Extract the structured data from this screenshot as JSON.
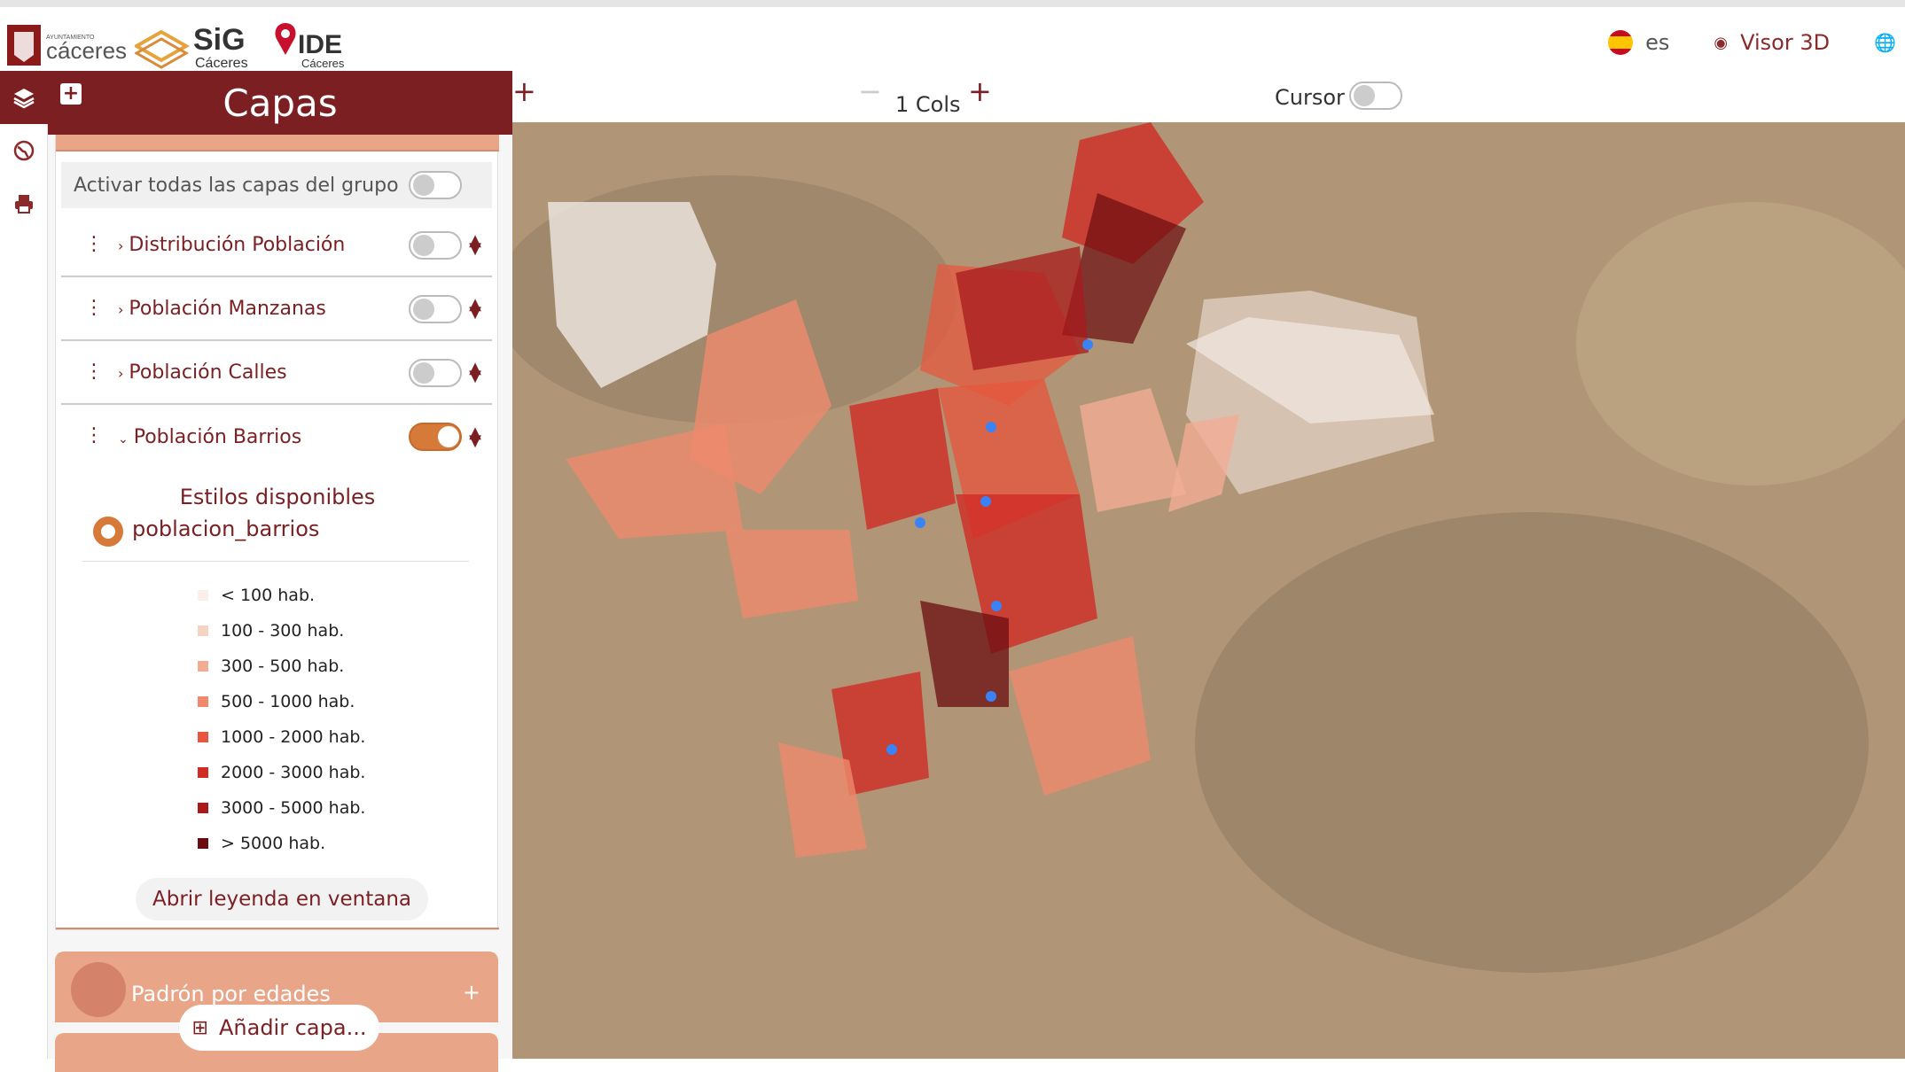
{
  "header": {
    "logos": [
      "Ayuntamiento Cáceres",
      "SIG Cáceres",
      "IDE Cáceres"
    ],
    "logo_texts": {
      "ayto_small": "AYUNTAMIENTO",
      "ayto": "cáceres",
      "sig": "SiG",
      "sig_sub": "Cáceres",
      "ide": "IDE",
      "ide_sub": "Cáceres"
    },
    "language": "es",
    "visor3d": "Visor 3D"
  },
  "panel": {
    "title": "Capas",
    "activar_label": "Activar todas las capas del grupo",
    "layers": [
      {
        "label": "Distribución Población",
        "enabled": false,
        "expanded": false
      },
      {
        "label": "Población Manzanas",
        "enabled": false,
        "expanded": false
      },
      {
        "label": "Población Calles",
        "enabled": false,
        "expanded": false
      },
      {
        "label": "Población Barrios",
        "enabled": true,
        "expanded": true
      }
    ],
    "estilos_title": "Estilos disponibles",
    "style_name": "poblacion_barrios",
    "legend": [
      {
        "label": "< 100 hab.",
        "color": "#fbefe9"
      },
      {
        "label": "100 - 300 hab.",
        "color": "#f7d3c4"
      },
      {
        "label": "300 - 500 hab.",
        "color": "#f2ad96"
      },
      {
        "label": "500 - 1000 hab.",
        "color": "#ef8a6e"
      },
      {
        "label": "1000 - 2000 hab.",
        "color": "#e5583f"
      },
      {
        "label": "2000 - 3000 hab.",
        "color": "#d02b25"
      },
      {
        "label": "3000 - 5000 hab.",
        "color": "#a81a1c"
      },
      {
        "label": "> 5000 hab.",
        "color": "#6b0c10"
      }
    ],
    "legend_button": "Abrir leyenda en ventana",
    "group2_title": "Padrón por edades",
    "add_layer": "Añadir capa..."
  },
  "map": {
    "cols_label": "1 Cols",
    "cursor_label": "Cursor",
    "cursor_on": false
  }
}
